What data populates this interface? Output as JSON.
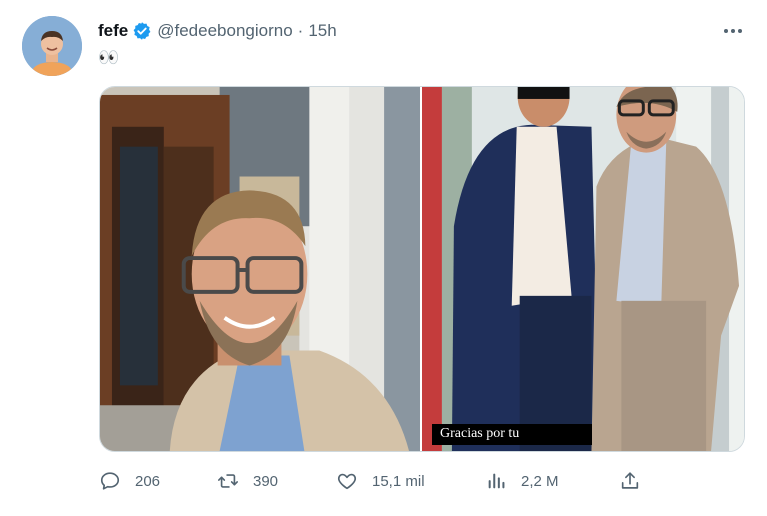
{
  "user": {
    "display_name": "fefe",
    "handle": "@fedeebongiorno",
    "separator": "·",
    "time": "15h"
  },
  "tweet": {
    "text": "👀"
  },
  "media": {
    "right_caption": "Gracias por tu"
  },
  "actions": {
    "replies": "206",
    "retweets": "390",
    "likes": "15,1 mil",
    "views": "2,2 M"
  },
  "colors": {
    "verified": "#1d9bf0",
    "secondary_text": "#536471",
    "border": "#cfd9de"
  },
  "icons": [
    "verified-badge-icon",
    "more-icon",
    "reply-icon",
    "retweet-icon",
    "like-icon",
    "views-icon",
    "share-icon"
  ]
}
